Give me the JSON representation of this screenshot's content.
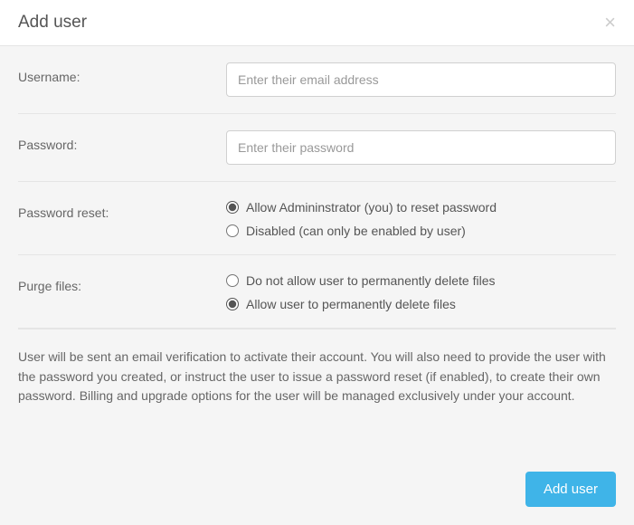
{
  "header": {
    "title": "Add user",
    "close_label": "×"
  },
  "form": {
    "username": {
      "label": "Username:",
      "placeholder": "Enter their email address",
      "value": ""
    },
    "password": {
      "label": "Password:",
      "placeholder": "Enter their password",
      "value": ""
    },
    "password_reset": {
      "label": "Password reset:",
      "options": {
        "allow": "Allow Admininstrator (you) to reset password",
        "disabled": "Disabled (can only be enabled by user)"
      },
      "selected": "allow"
    },
    "purge_files": {
      "label": "Purge files:",
      "options": {
        "disallow": "Do not allow user to permanently delete files",
        "allow": "Allow user to permanently delete files"
      },
      "selected": "allow"
    }
  },
  "info_text": "User will be sent an email verification to activate their account. You will also need to provide the user with the password you created, or instruct the user to issue a password reset (if enabled), to create their own password. Billing and upgrade options for the user will be managed exclusively under your account.",
  "footer": {
    "submit_label": "Add user"
  }
}
